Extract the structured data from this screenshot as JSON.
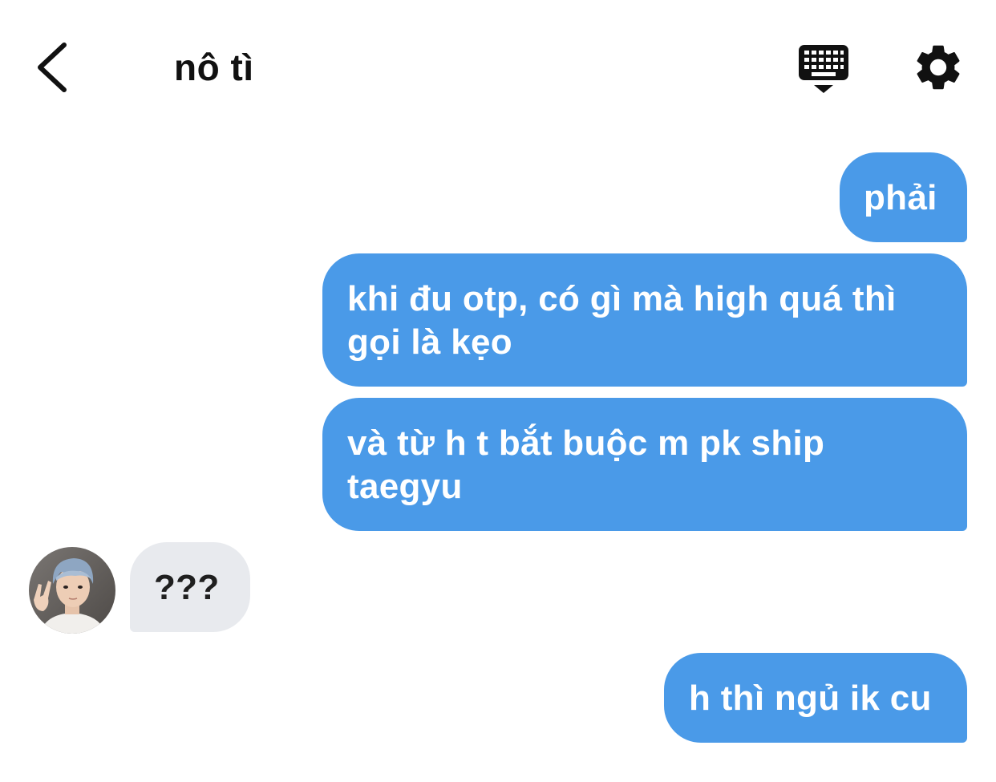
{
  "header": {
    "title": "nô tì",
    "back_icon": "chevron-left-icon",
    "keyboard_icon": "keyboard-hide-icon",
    "settings_icon": "gear-icon"
  },
  "messages": [
    {
      "direction": "outgoing",
      "text": "phải"
    },
    {
      "direction": "outgoing",
      "text": "khi đu otp, có gì mà high quá thì gọi là kẹo"
    },
    {
      "direction": "outgoing",
      "text": "và từ h t bắt buộc m pk ship taegyu"
    },
    {
      "direction": "incoming",
      "text": "???",
      "has_avatar": true
    },
    {
      "direction": "outgoing",
      "text": "h thì ngủ ik cu"
    }
  ],
  "colors": {
    "outgoing_bubble": "#4a9ae8",
    "incoming_bubble": "#e8eaee",
    "background": "#ffffff",
    "text_dark": "#111111"
  }
}
